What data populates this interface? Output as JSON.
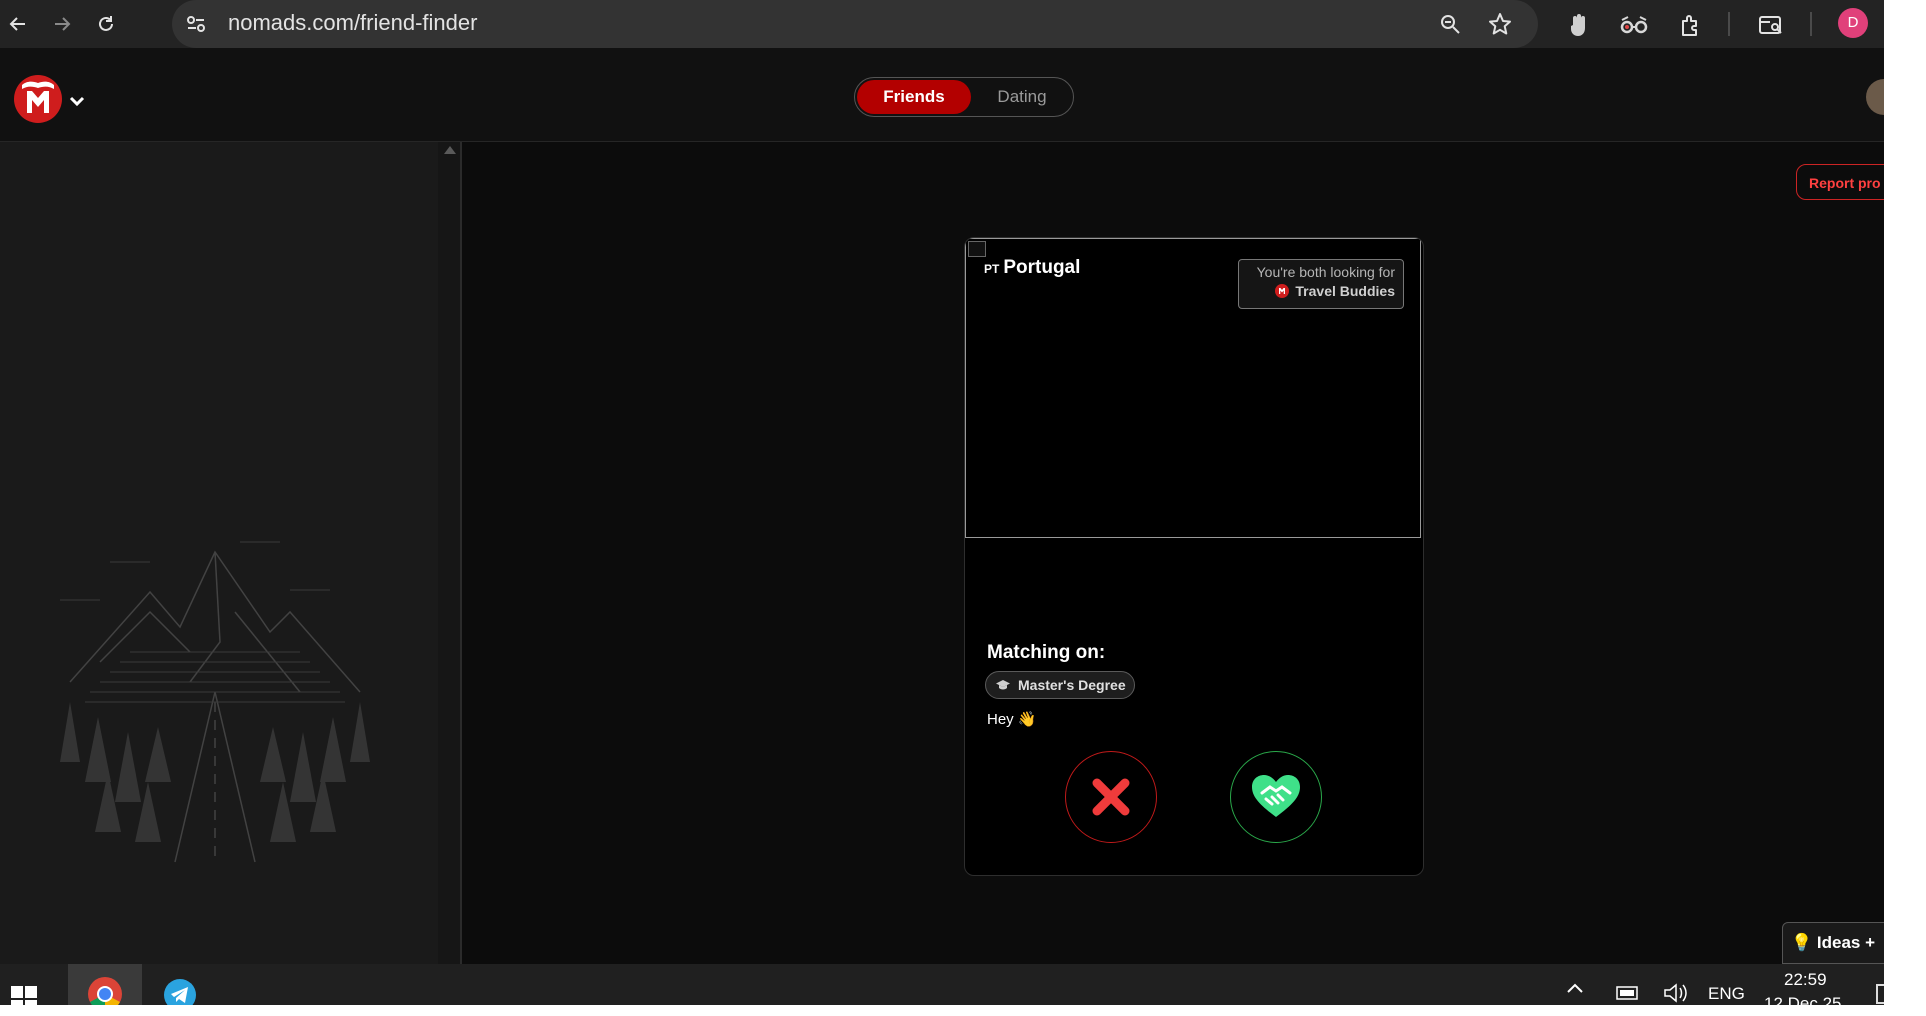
{
  "browser": {
    "url": "nomads.com/friend-finder",
    "profile_initial": "D",
    "icons": [
      "back-arrow-icon",
      "forward-arrow-icon",
      "reload-icon",
      "site-info-icon",
      "zoom-icon",
      "bookmark-star-icon",
      "extension-hand-icon",
      "extension-glasses-icon",
      "extensions-puzzle-icon",
      "tab-search-icon"
    ]
  },
  "app": {
    "mode_tabs": {
      "friends": "Friends",
      "dating": "Dating",
      "active": "Friends"
    },
    "report_label": "Report pro",
    "ideas_label": "Ideas +"
  },
  "card": {
    "country_code": "PT",
    "country": "Portugal",
    "looking_label": "You're both looking for",
    "looking_value": "Travel Buddies",
    "matching_title": "Matching on:",
    "match_tags": [
      {
        "label": "Master's Degree",
        "icon": "graduation-cap-icon"
      }
    ],
    "greeting": "Hey 👋"
  },
  "taskbar": {
    "language": "ENG",
    "time": "22:59",
    "date_partial": "12 Dec 25"
  },
  "colors": {
    "accent_red": "#b30000",
    "match_green": "#2aa84a",
    "reject_red": "#ef3b3b",
    "page_bg": "#0c0c0c",
    "chrome_bg": "#232323"
  }
}
